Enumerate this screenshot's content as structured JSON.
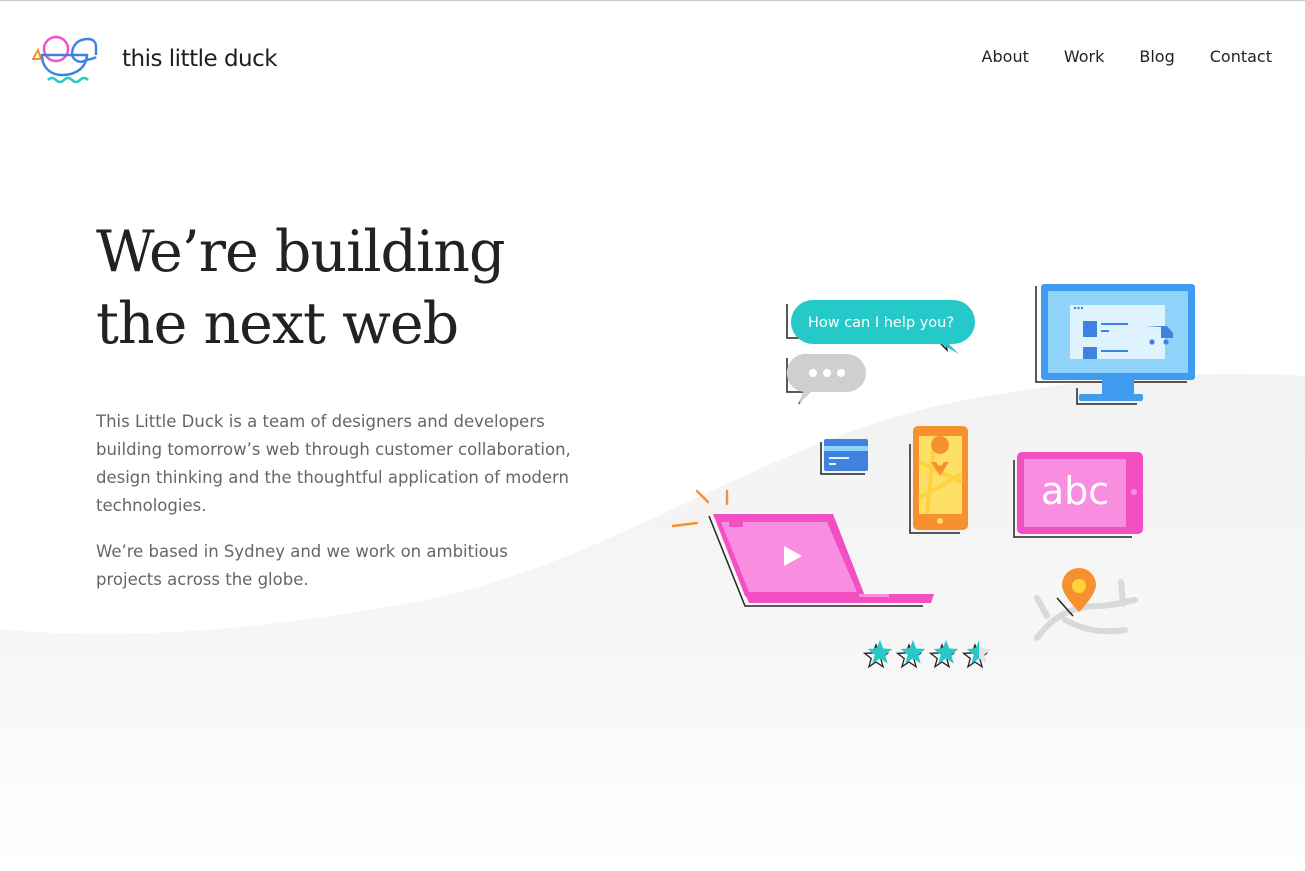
{
  "brand": {
    "name": "this little duck",
    "colors": {
      "pink": "#f24fc3",
      "teal": "#25c9c9",
      "blue": "#3f82e0",
      "orange": "#f7902e"
    }
  },
  "nav": {
    "items": [
      {
        "label": "About"
      },
      {
        "label": "Work"
      },
      {
        "label": "Blog"
      },
      {
        "label": "Contact"
      }
    ]
  },
  "hero": {
    "title_line1": "We’re building",
    "title_line2": "the next web",
    "paragraph1": "This Little Duck is a team of designers and developers building tomorrow’s web through customer collaboration, design thinking and the thoughtful application of modern technologies.",
    "paragraph2": "We’re based in Sydney and we work on ambitious projects across the globe."
  },
  "illustration": {
    "chat_bubble_text": "How can I help you?",
    "tablet_text": "abc",
    "rating": 3.5,
    "rating_max": 4
  }
}
